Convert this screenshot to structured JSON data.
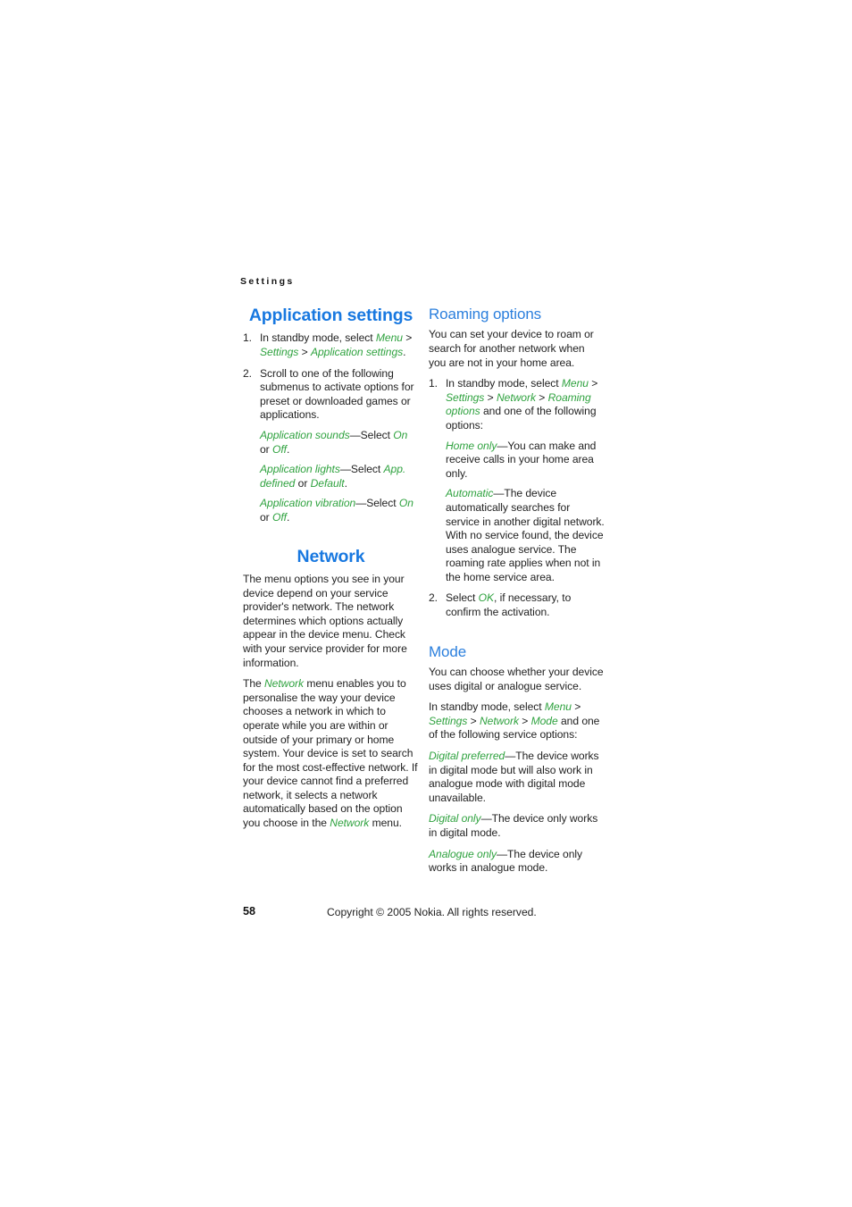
{
  "page": {
    "running_header": "Settings",
    "page_number": "58",
    "copyright": "Copyright © 2005 Nokia. All rights reserved.",
    "colors": {
      "heading_blue": "#1878e0",
      "subheading_blue": "#2b7fdd",
      "term_green": "#2fa23f",
      "body_text": "#222222",
      "background": "#ffffff"
    }
  },
  "left_column": {
    "section1": {
      "title": "Application settings",
      "steps": [
        {
          "number": "1.",
          "parts": [
            {
              "t": "text",
              "v": "In standby mode, select "
            },
            {
              "t": "term",
              "v": "Menu"
            },
            {
              "t": "text",
              "v": " > "
            },
            {
              "t": "term",
              "v": "Settings"
            },
            {
              "t": "text",
              "v": " > "
            },
            {
              "t": "term",
              "v": "Application settings"
            },
            {
              "t": "text",
              "v": "."
            }
          ],
          "plain": "In standby mode, select Menu > Settings > Application settings."
        },
        {
          "number": "2.",
          "plain": "Scroll to one of the following submenus to activate options for preset or downloaded games or applications.",
          "definitions": [
            {
              "term": "Application sounds",
              "separator": "—Select ",
              "values": [
                "On",
                "Off"
              ],
              "plain": "Application sounds—Select On or Off."
            },
            {
              "term": "Application lights",
              "separator": "—Select ",
              "values": [
                "App. defined",
                "Default"
              ],
              "plain": "Application lights—Select App. defined or Default."
            },
            {
              "term": "Application vibration",
              "separator": "—Select ",
              "values": [
                "On",
                "Off"
              ],
              "plain": "Application vibration—Select On or Off."
            }
          ]
        }
      ]
    },
    "section2": {
      "title": "Network",
      "paragraph1": "The menu options you see in your device depend on your service provider's network. The network determines which options actually appear in the device menu. Check with your service provider for more information.",
      "paragraph2": {
        "plain": "The Network menu enables you to personalise the way your device chooses a network in which to operate while you are within or outside of your primary or home system. Your device is set to search for the most cost-effective network. If your device cannot find a preferred network, it selects a network automatically based on the option you choose in the Network menu.",
        "lead": "The ",
        "term1": "Network",
        "middle": " menu enables you to personalise the way your device chooses a network in which to operate while you are within or outside of your primary or home system. Your device is set to search for the most cost-effective network. If your device cannot find a preferred network, it selects a network automatically based on the option you choose in the ",
        "term2": "Network",
        "tail": " menu."
      }
    }
  },
  "right_column": {
    "section1": {
      "title": "Roaming options",
      "intro": "You can set your device to roam or search for another network when you are not in your home area.",
      "steps": [
        {
          "number": "1.",
          "lead": "In standby mode, select ",
          "terms": [
            "Menu",
            "Settings",
            "Network",
            "Roaming options"
          ],
          "tail": " and one of the following options:",
          "plain": "In standby mode, select Menu > Settings > Network > Roaming options and one of the following options:",
          "definitions": [
            {
              "term": "Home only",
              "text": "—You can make and receive calls in your home area only.",
              "plain": "Home only—You can make and receive calls in your home area only."
            },
            {
              "term": "Automatic",
              "text": "—The device automatically searches for service in another digital network. With no service found, the device uses analogue service. The roaming rate applies when not in the home service area.",
              "plain": "Automatic—The device automatically searches for service in another digital network. With no service found, the device uses analogue service. The roaming rate applies when not in the home service area."
            }
          ]
        },
        {
          "number": "2.",
          "lead": "Select ",
          "term": "OK",
          "tail": ", if necessary, to confirm the activation.",
          "plain": "Select OK, if necessary, to confirm the activation."
        }
      ]
    },
    "section2": {
      "title": "Mode",
      "intro": "You can choose whether your device uses digital or analogue service.",
      "path_lead": "In standby mode, select ",
      "path_terms": [
        "Menu",
        "Settings",
        "Network",
        "Mode"
      ],
      "path_tail": " and one of the following service options:",
      "path_plain": "In standby mode, select Menu > Settings > Network > Mode and one of the following service options:",
      "definitions": [
        {
          "term": "Digital preferred",
          "text": "—The device works in digital mode but will also work in analogue mode with digital mode unavailable.",
          "plain": "Digital preferred—The device works in digital mode but will also work in analogue mode with digital mode unavailable."
        },
        {
          "term": "Digital only",
          "text": "—The device only works in digital mode.",
          "plain": "Digital only—The device only works in digital mode."
        },
        {
          "term": "Analogue only",
          "text": "—The device only works in analogue mode.",
          "plain": "Analogue only—The device only works in analogue mode."
        }
      ]
    }
  }
}
